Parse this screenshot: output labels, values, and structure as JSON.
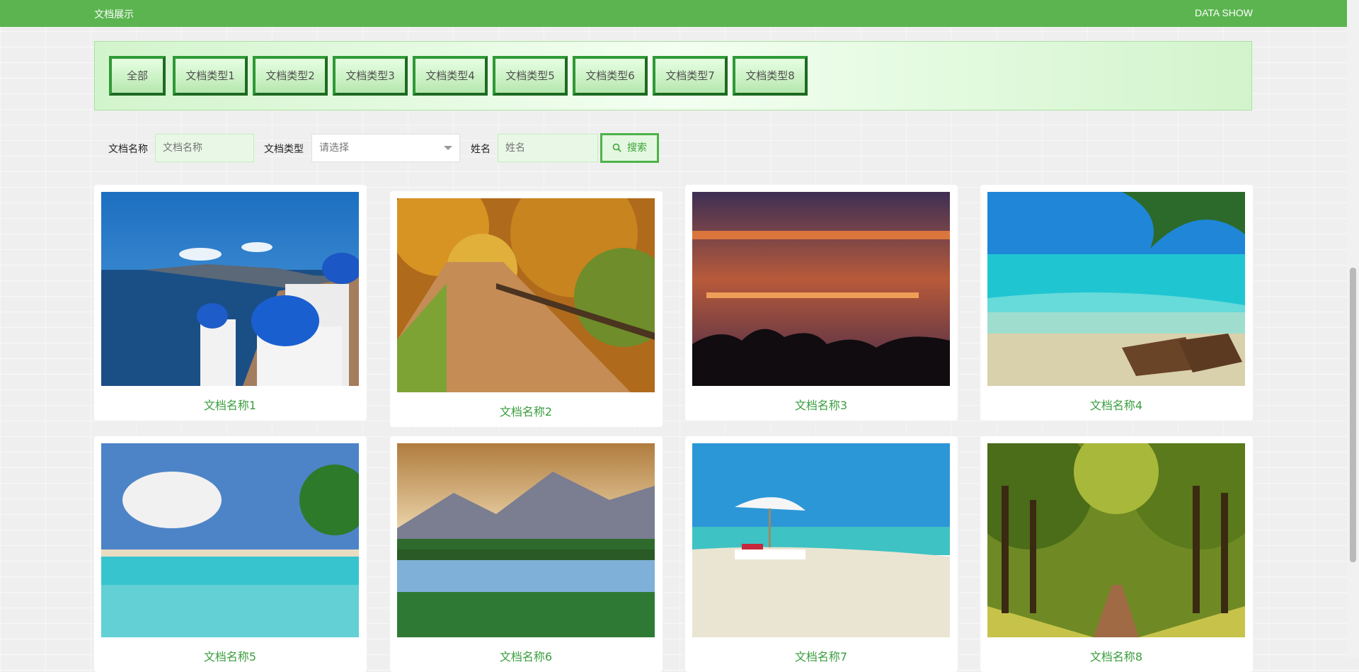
{
  "header": {
    "brand": "文档展示",
    "right_title": "DATA SHOW"
  },
  "categories": [
    "全部",
    "文档类型1",
    "文档类型2",
    "文档类型3",
    "文档类型4",
    "文档类型5",
    "文档类型6",
    "文档类型7",
    "文档类型8"
  ],
  "search": {
    "name_label": "文档名称",
    "name_placeholder": "文档名称",
    "type_label": "文档类型",
    "type_selected": "请选择",
    "person_label": "姓名",
    "person_placeholder": "姓名",
    "button_label": "搜索"
  },
  "documents": [
    {
      "title": "文档名称1",
      "image": "Santorini coast with blue domes"
    },
    {
      "title": "文档名称2",
      "image": "autumn forest path with fence"
    },
    {
      "title": "文档名称3",
      "image": "red sunset over tree silhouettes"
    },
    {
      "title": "文档名称4",
      "image": "tropical beach with palm and loungers"
    },
    {
      "title": "文档名称5",
      "image": "beach split view with palms"
    },
    {
      "title": "文档名称6",
      "image": "mountain lake reflection"
    },
    {
      "title": "文档名称7",
      "image": "white sand beach with umbrella"
    },
    {
      "title": "文档名称8",
      "image": "green tree-lined avenue"
    }
  ],
  "colors": {
    "accent": "#5bb450",
    "title_text": "#3a9e3e"
  }
}
